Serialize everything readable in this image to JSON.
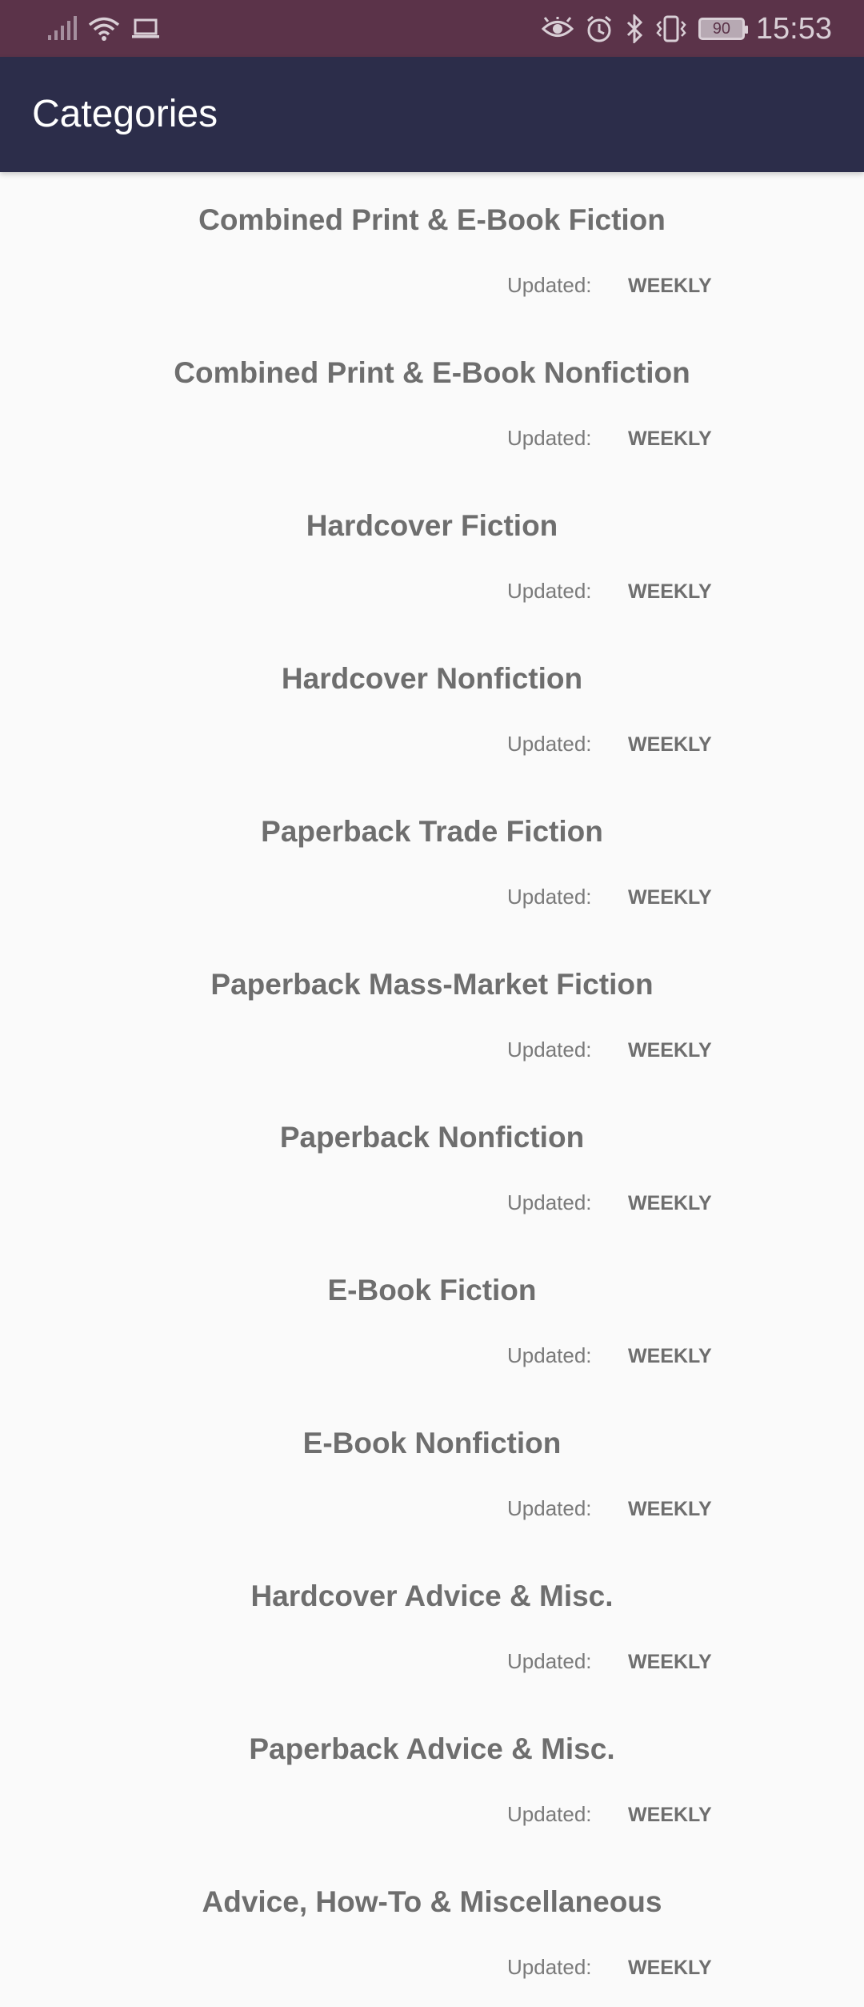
{
  "status_bar": {
    "time": "15:53",
    "battery": "90",
    "icons": [
      "signal-icon",
      "wifi-icon",
      "laptop-icon",
      "eye-icon",
      "alarm-icon",
      "bluetooth-icon",
      "vibrate-icon",
      "battery-icon"
    ]
  },
  "app_bar": {
    "title": "Categories"
  },
  "categories": [
    {
      "name": "Combined Print & E-Book Fiction",
      "updated_label": "Updated:",
      "frequency": "WEEKLY"
    },
    {
      "name": "Combined Print & E-Book Nonfiction",
      "updated_label": "Updated:",
      "frequency": "WEEKLY"
    },
    {
      "name": "Hardcover Fiction",
      "updated_label": "Updated:",
      "frequency": "WEEKLY"
    },
    {
      "name": "Hardcover Nonfiction",
      "updated_label": "Updated:",
      "frequency": "WEEKLY"
    },
    {
      "name": "Paperback Trade Fiction",
      "updated_label": "Updated:",
      "frequency": "WEEKLY"
    },
    {
      "name": "Paperback Mass-Market Fiction",
      "updated_label": "Updated:",
      "frequency": "WEEKLY"
    },
    {
      "name": "Paperback Nonfiction",
      "updated_label": "Updated:",
      "frequency": "WEEKLY"
    },
    {
      "name": "E-Book Fiction",
      "updated_label": "Updated:",
      "frequency": "WEEKLY"
    },
    {
      "name": "E-Book Nonfiction",
      "updated_label": "Updated:",
      "frequency": "WEEKLY"
    },
    {
      "name": "Hardcover Advice & Misc.",
      "updated_label": "Updated:",
      "frequency": "WEEKLY"
    },
    {
      "name": "Paperback Advice & Misc.",
      "updated_label": "Updated:",
      "frequency": "WEEKLY"
    },
    {
      "name": "Advice, How-To & Miscellaneous",
      "updated_label": "Updated:",
      "frequency": "WEEKLY"
    }
  ]
}
